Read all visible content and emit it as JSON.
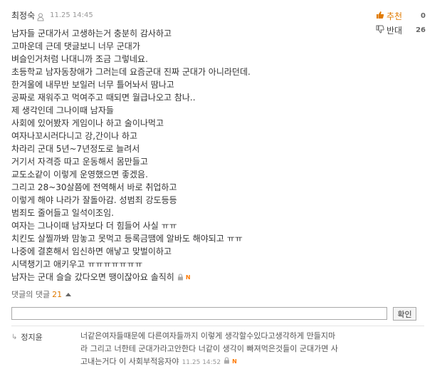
{
  "comment": {
    "author": "최정숙",
    "time": "11.25 14:45",
    "recommend_label": "추천",
    "recommend_count": "0",
    "oppose_label": "반대",
    "oppose_count": "26",
    "lines": [
      "남자들 군대가서 고생하는거 충분히 감사하고",
      "고마운데 근데 댓글보니 너무 군대가",
      "벼슬인거처럼 나대니까 조금 그렇네요.",
      "초등학교 남자동창애가 그러는데 요즘군대 진짜 군대가 아니라던데.",
      "한겨울에 내무반 보일러 너무 틀어놔서 땀나고",
      "공짜로 재워주고 먹여주고 때되면 월급나오고 참나..",
      "제 생각인데 그나이때 남자들",
      "사회에 있어봤자 게임이나 하고 술이나먹고",
      "여자나꼬시러다니고 강,간이나 하고",
      "차라리 군대 5년~7년정도로 늘려서",
      "거기서 자격증 따고 운동해서 몸만들고",
      "교도소같이 이렇게 운영했으면 좋겠음.",
      "그리고 28~30살쯤에 전역해서 바로 취업하고",
      "이렇게 해야 나라가 잘돌아감. 성범죄 강도등등",
      "범죄도 줄어들고 일석이조임.",
      "여자는 그나이때 남자보다 더 힘들어 사실 ㅠㅠ",
      "치킨도 살찔까봐 맘놓고 못먹고 등록금땜에 알바도 해야되고 ㅠㅠ",
      "나중에 결혼해서 임신하면 애낳고 맞벌이하고",
      "시댁챙기고 애키우고 ㅠㅠㅠㅠㅠㅠㅠ",
      "남자는 군대 슬슬 갔다오면 땡이잖아요 솔직히"
    ],
    "new_badge": "N"
  },
  "replies_toggle": {
    "label": "댓글의 댓글",
    "count": "21"
  },
  "reply_form": {
    "value": "",
    "confirm_label": "확인"
  },
  "reply": {
    "author": "정지윤",
    "line1": "너같은여자들때문에 다른여자들까지 이렇게 생각할수있다고생각하게 만들지마",
    "line2": "라 그리고 너한테 군대가라고안한다 너같이 생각이 빠져먹은것들이 군대가면 사",
    "line3": "고내는거다 이 사회부적응자야",
    "time": "11.25 14:52",
    "new_badge": "N"
  },
  "colors": {
    "accent": "#e07a00",
    "text": "#333333",
    "muted": "#999999"
  }
}
